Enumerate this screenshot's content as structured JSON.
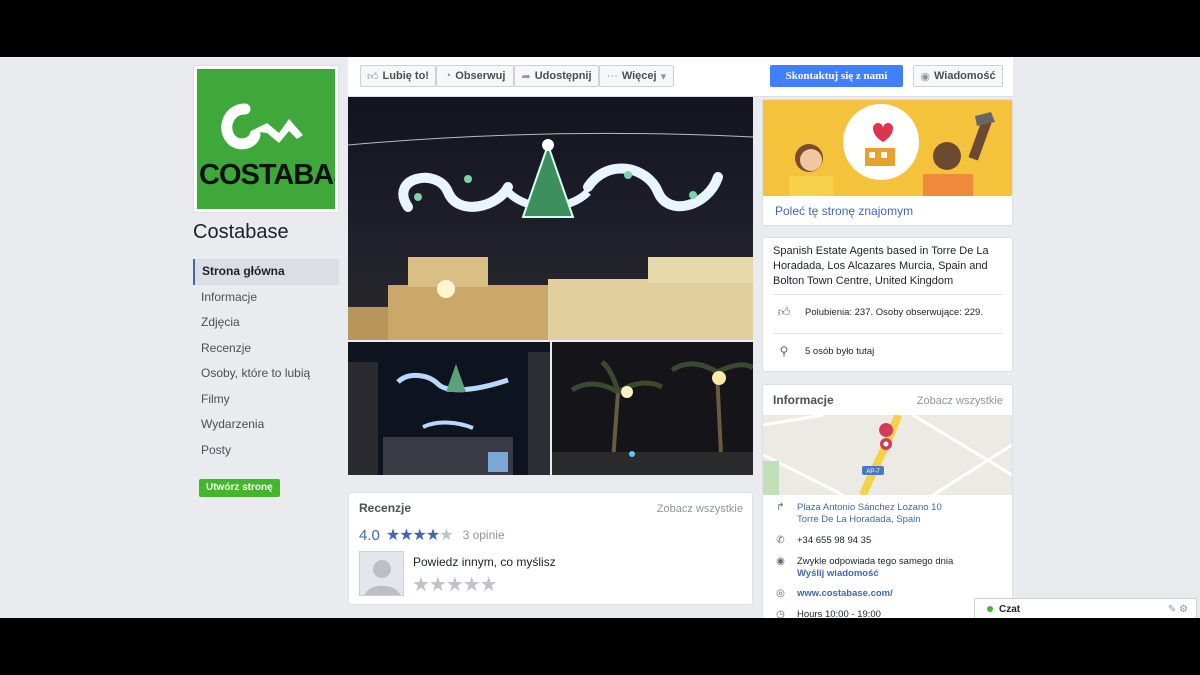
{
  "page": {
    "name": "Costabase",
    "logo_text": "COSTABASE"
  },
  "nav": {
    "items": [
      {
        "label": "Strona główna"
      },
      {
        "label": "Informacje"
      },
      {
        "label": "Zdjęcia"
      },
      {
        "label": "Recenzje"
      },
      {
        "label": "Osoby, które to lubią"
      },
      {
        "label": "Filmy"
      },
      {
        "label": "Wydarzenia"
      },
      {
        "label": "Posty"
      }
    ],
    "create_page": "Utwórz stronę"
  },
  "actions": {
    "like": "Lubię to!",
    "follow": "Obserwuj",
    "share": "Udostępnij",
    "more": "Więcej",
    "contact": "Skontaktuj się z nami",
    "message": "Wiadomość"
  },
  "reviews": {
    "title": "Recenzje",
    "see_all": "Zobacz wszystkie",
    "score": "4.0",
    "stars_filled": 4,
    "stars_total": 5,
    "count": "3 opinie",
    "prompt": "Powiedz innym, co myślisz"
  },
  "recommend": {
    "link": "Poleć tę stronę znajomym"
  },
  "about": {
    "description": "Spanish Estate Agents based in Torre De La Horadada, Los Alcazares Murcia, Spain and Bolton Town Centre, United Kingdom",
    "likes": "Polubienia: 237. Osoby obserwujące: 229.",
    "checkins": "5 osób było tutaj"
  },
  "info": {
    "title": "Informacje",
    "see_all": "Zobacz wszystkie",
    "map_badge": "AP-7",
    "address_line1": "Plaza Antonio Sánchez Lozano 10",
    "address_line2": "Torre De La Horadada, Spain",
    "phone": "+34 655 98 94 35",
    "response": "Zwykle odpowiada tego samego dnia",
    "send_message": "Wyślij wiadomość",
    "website": "www.costabase.com/",
    "hours": "Hours 10:00 - 19:00"
  },
  "chat": {
    "label": "Czat"
  },
  "colors": {
    "brand_blue": "#4267b2",
    "contact_blue": "#4080ff",
    "create_green": "#42b72a",
    "logo_green": "#3ea83a",
    "background": "#e9ebee"
  },
  "icons": [
    "thumbs-up-icon",
    "rss-icon",
    "share-icon",
    "more-dots-icon",
    "chevron-down-icon",
    "messenger-icon",
    "star-icon",
    "user-placeholder-icon",
    "map-pin-icon",
    "directions-icon",
    "phone-icon",
    "chat-bubble-icon",
    "globe-icon",
    "clock-icon",
    "compose-icon",
    "gear-icon"
  ]
}
